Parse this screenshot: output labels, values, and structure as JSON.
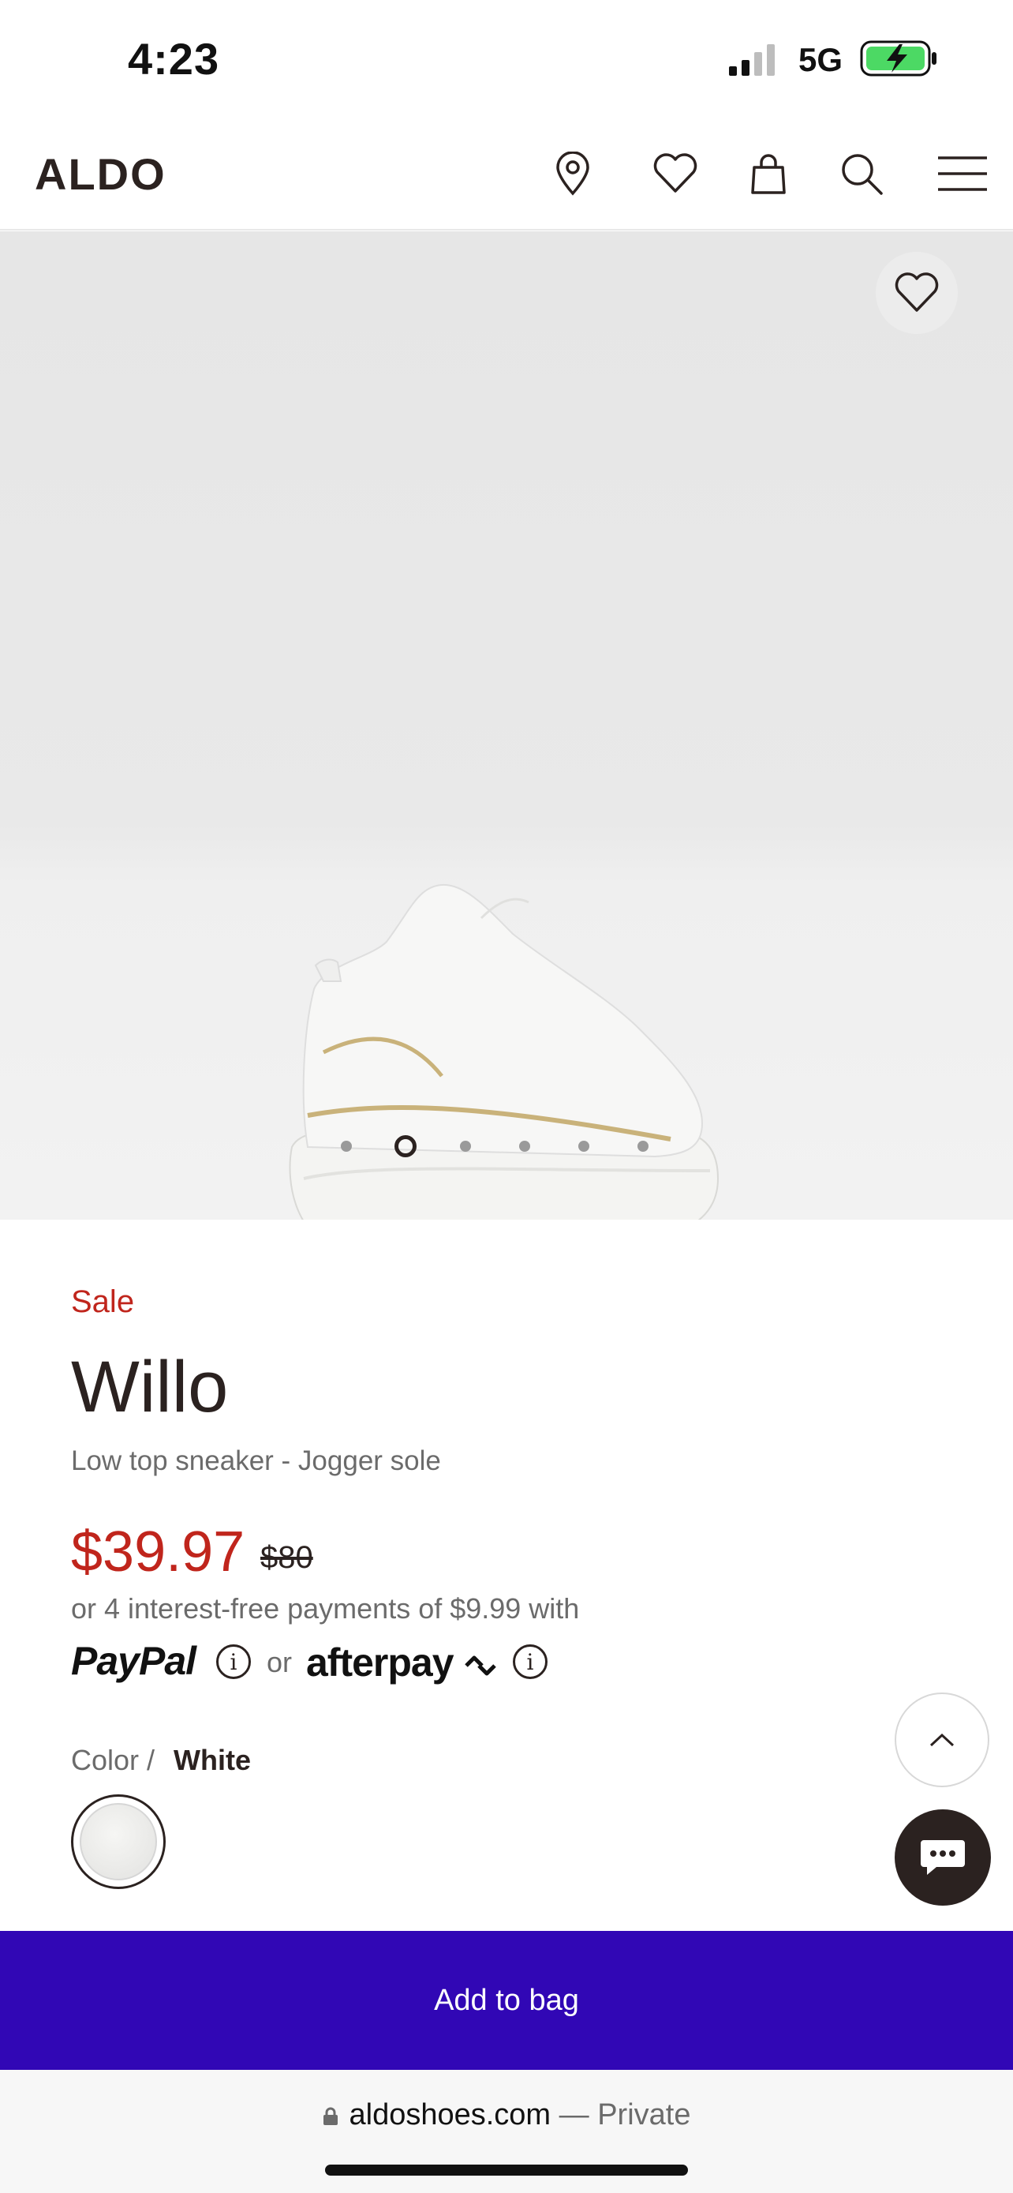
{
  "status_bar": {
    "time": "4:23",
    "network": "5G",
    "signal_bars": 2,
    "signal_total": 4,
    "battery_state": "charging",
    "battery_color": "#4cd964"
  },
  "header": {
    "logo": "ALDO",
    "icons": [
      "store-locator-icon",
      "wishlist-icon",
      "bag-icon",
      "search-icon",
      "menu-icon"
    ]
  },
  "gallery": {
    "current_index": 2,
    "total_images": 6,
    "favorite_icon": "heart-outline-icon"
  },
  "product": {
    "badge": "Sale",
    "name": "Willo",
    "description": "Low top sneaker - Jogger sole",
    "sale_price": "$39.97",
    "original_price": "$80",
    "installments": "or 4 interest-free payments of $9.99 with",
    "paypal": "PayPal",
    "or": "or",
    "afterpay": "afterpay",
    "info_glyph": "i",
    "color_label": "Color /",
    "color_value": "White"
  },
  "actions": {
    "add_to_bag": "Add to bag"
  },
  "browser": {
    "domain": "aldoshoes.com",
    "privacy": " — Private"
  },
  "colors": {
    "sale": "#c0251c",
    "cta": "#3107b5",
    "text": "#2b2220",
    "chat": "#2b2220"
  }
}
